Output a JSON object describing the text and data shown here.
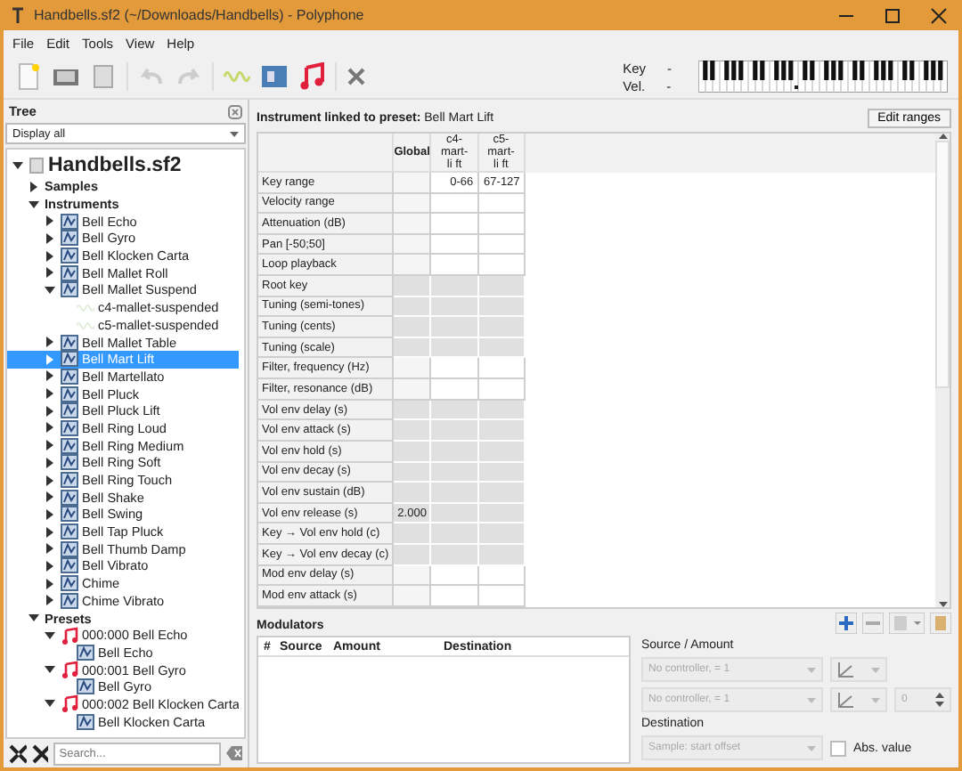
{
  "window": {
    "title": "Handbells.sf2 (~/Downloads/Handbells) - Polyphone"
  },
  "menu": [
    "File",
    "Edit",
    "Tools",
    "View",
    "Help"
  ],
  "toolbar": {
    "key_label": "Key",
    "key_value": "-",
    "vel_label": "Vel.",
    "vel_value": "-"
  },
  "tree": {
    "title": "Tree",
    "filter": "Display all",
    "search_placeholder": "Search...",
    "root": {
      "label": "Handbells.sf2",
      "expanded": true,
      "children": [
        {
          "label": "Samples",
          "kind": "group",
          "expanded": false
        },
        {
          "label": "Instruments",
          "kind": "group",
          "expanded": true,
          "children": [
            {
              "label": "Bell Echo",
              "kind": "instrument",
              "expanded": false,
              "selected": false
            },
            {
              "label": "Bell Gyro",
              "kind": "instrument",
              "expanded": false,
              "selected": false
            },
            {
              "label": "Bell Klocken Carta",
              "kind": "instrument",
              "expanded": false,
              "selected": false
            },
            {
              "label": "Bell Mallet Roll",
              "kind": "instrument",
              "expanded": false,
              "selected": false
            },
            {
              "label": "Bell Mallet Suspend",
              "kind": "instrument",
              "expanded": true,
              "selected": false,
              "children": [
                {
                  "label": "c4-mallet-suspended",
                  "kind": "sample",
                  "selected": false
                },
                {
                  "label": "c5-mallet-suspended",
                  "kind": "sample",
                  "selected": false
                }
              ]
            },
            {
              "label": "Bell Mallet Table",
              "kind": "instrument",
              "expanded": false,
              "selected": false
            },
            {
              "label": "Bell Mart Lift",
              "kind": "instrument",
              "expanded": false,
              "selected": true
            },
            {
              "label": "Bell Martellato",
              "kind": "instrument",
              "expanded": false,
              "selected": false
            },
            {
              "label": "Bell Pluck",
              "kind": "instrument",
              "expanded": false,
              "selected": false
            },
            {
              "label": "Bell Pluck Lift",
              "kind": "instrument",
              "expanded": false,
              "selected": false
            },
            {
              "label": "Bell Ring Loud",
              "kind": "instrument",
              "expanded": false,
              "selected": false
            },
            {
              "label": "Bell Ring Medium",
              "kind": "instrument",
              "expanded": false,
              "selected": false
            },
            {
              "label": "Bell Ring Soft",
              "kind": "instrument",
              "expanded": false,
              "selected": false
            },
            {
              "label": "Bell Ring Touch",
              "kind": "instrument",
              "expanded": false,
              "selected": false
            },
            {
              "label": "Bell Shake",
              "kind": "instrument",
              "expanded": false,
              "selected": false
            },
            {
              "label": "Bell Swing",
              "kind": "instrument",
              "expanded": false,
              "selected": false
            },
            {
              "label": "Bell Tap Pluck",
              "kind": "instrument",
              "expanded": false,
              "selected": false
            },
            {
              "label": "Bell Thumb Damp",
              "kind": "instrument",
              "expanded": false,
              "selected": false
            },
            {
              "label": "Bell Vibrato",
              "kind": "instrument",
              "expanded": false,
              "selected": false
            },
            {
              "label": "Chime",
              "kind": "instrument",
              "expanded": false,
              "selected": false
            },
            {
              "label": "Chime Vibrato",
              "kind": "instrument",
              "expanded": false,
              "selected": false
            }
          ]
        },
        {
          "label": "Presets",
          "kind": "group",
          "expanded": true,
          "children": [
            {
              "label": "000:000 Bell Echo",
              "kind": "preset",
              "expanded": true,
              "selected": false,
              "children": [
                {
                  "label": "Bell Echo",
                  "kind": "instrument",
                  "selected": false
                }
              ]
            },
            {
              "label": "000:001 Bell Gyro",
              "kind": "preset",
              "expanded": true,
              "selected": false,
              "children": [
                {
                  "label": "Bell Gyro",
                  "kind": "instrument",
                  "selected": false
                }
              ]
            },
            {
              "label": "000:002 Bell Klocken Carta",
              "kind": "preset",
              "expanded": true,
              "selected": false,
              "children": [
                {
                  "label": "Bell Klocken Carta",
                  "kind": "instrument",
                  "selected": false
                }
              ]
            }
          ]
        }
      ]
    }
  },
  "editor": {
    "heading_label": "Instrument linked to preset:",
    "heading_value": "Bell Mart Lift",
    "edit_ranges": "Edit ranges",
    "columns": [
      "Global",
      "c4-mart-li ft",
      "c5-mart-li ft"
    ],
    "rows": [
      {
        "label": "Key range",
        "shaded": false,
        "cells": [
          "",
          "0-66",
          "67-127"
        ]
      },
      {
        "label": "Velocity range",
        "shaded": false,
        "cells": [
          "",
          "",
          ""
        ]
      },
      {
        "label": "Attenuation (dB)",
        "shaded": false,
        "cells": [
          "",
          "",
          ""
        ]
      },
      {
        "label": "Pan [-50;50]",
        "shaded": false,
        "cells": [
          "",
          "",
          ""
        ]
      },
      {
        "label": "Loop playback",
        "shaded": false,
        "cells": [
          "",
          "",
          ""
        ]
      },
      {
        "label": "Root key",
        "shaded": true,
        "cells": [
          "",
          "",
          ""
        ]
      },
      {
        "label": "Tuning (semi-tones)",
        "shaded": true,
        "cells": [
          "",
          "",
          ""
        ]
      },
      {
        "label": "Tuning (cents)",
        "shaded": true,
        "cells": [
          "",
          "",
          ""
        ]
      },
      {
        "label": "Tuning (scale)",
        "shaded": true,
        "cells": [
          "",
          "",
          ""
        ]
      },
      {
        "label": "Filter, frequency (Hz)",
        "shaded": false,
        "cells": [
          "",
          "",
          ""
        ]
      },
      {
        "label": "Filter, resonance (dB)",
        "shaded": false,
        "cells": [
          "",
          "",
          ""
        ]
      },
      {
        "label": "Vol env delay (s)",
        "shaded": true,
        "cells": [
          "",
          "",
          ""
        ]
      },
      {
        "label": "Vol env attack (s)",
        "shaded": true,
        "cells": [
          "",
          "",
          ""
        ]
      },
      {
        "label": "Vol env hold (s)",
        "shaded": true,
        "cells": [
          "",
          "",
          ""
        ]
      },
      {
        "label": "Vol env decay (s)",
        "shaded": true,
        "cells": [
          "",
          "",
          ""
        ]
      },
      {
        "label": "Vol env sustain (dB)",
        "shaded": true,
        "cells": [
          "",
          "",
          ""
        ]
      },
      {
        "label": "Vol env release (s)",
        "shaded": true,
        "cells": [
          "2.000",
          "",
          ""
        ]
      },
      {
        "label": "Key → Vol env hold (c)",
        "shaded": true,
        "cells": [
          "",
          "",
          ""
        ]
      },
      {
        "label": "Key → Vol env decay (c)",
        "shaded": true,
        "cells": [
          "",
          "",
          ""
        ]
      },
      {
        "label": "Mod env delay (s)",
        "shaded": false,
        "cells": [
          "",
          "",
          ""
        ]
      },
      {
        "label": "Mod env attack (s)",
        "shaded": false,
        "cells": [
          "",
          "",
          ""
        ]
      }
    ]
  },
  "modulators": {
    "title": "Modulators",
    "columns": [
      "#",
      "Source",
      "Amount",
      "Destination"
    ],
    "source_amount_label": "Source / Amount",
    "source_1": "No controller, = 1",
    "source_2": "No controller, = 1",
    "amount": "0",
    "destination_label": "Destination",
    "destination": "Sample: start offset",
    "abs_label": "Abs. value",
    "abs_checked": false
  }
}
